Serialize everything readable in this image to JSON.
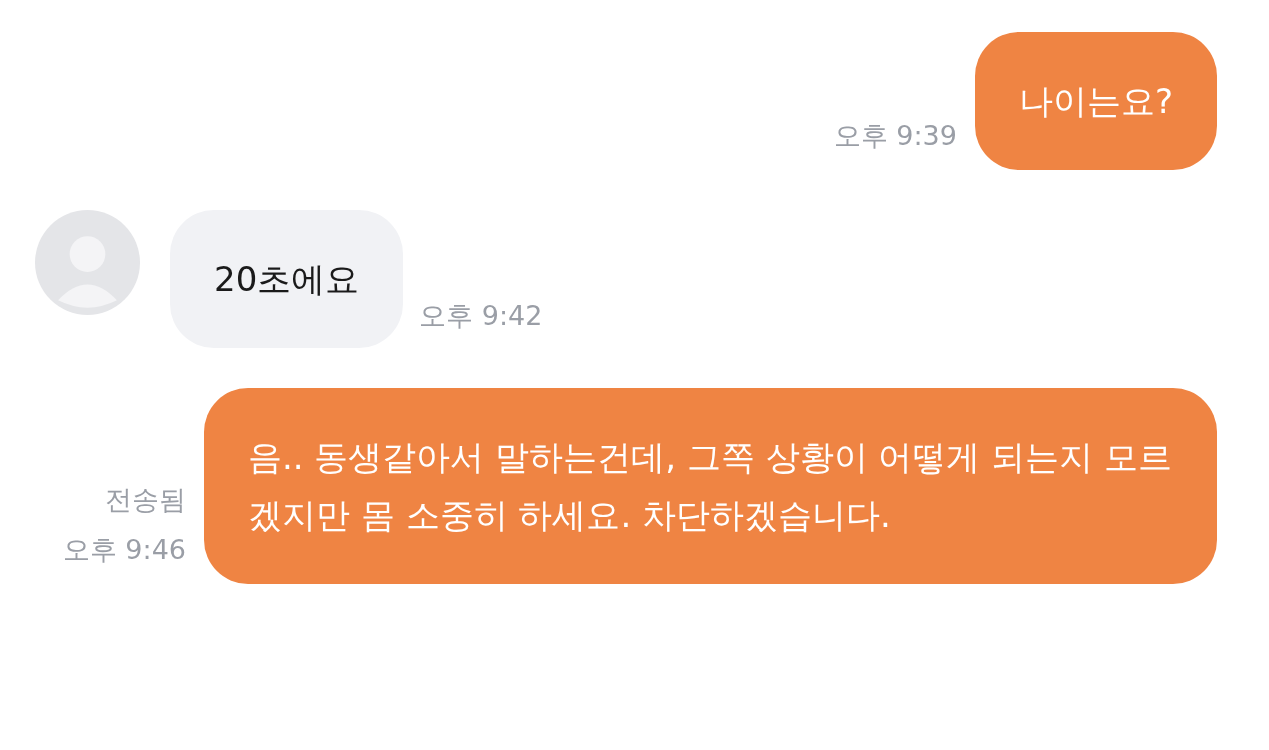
{
  "messages": [
    {
      "kind": "outgoing",
      "text": "나이는요?",
      "time": "오후 9:39"
    },
    {
      "kind": "incoming",
      "text": "20초에요",
      "time": "오후 9:42"
    },
    {
      "kind": "outgoing",
      "text": "음.. 동생같아서 말하는건데, 그쪽 상황이 어떻게 되는지 모르겠지만 몸 소중히 하세요. 차단하겠습니다.",
      "time": "오후 9:46",
      "status": "전송됨"
    }
  ]
}
